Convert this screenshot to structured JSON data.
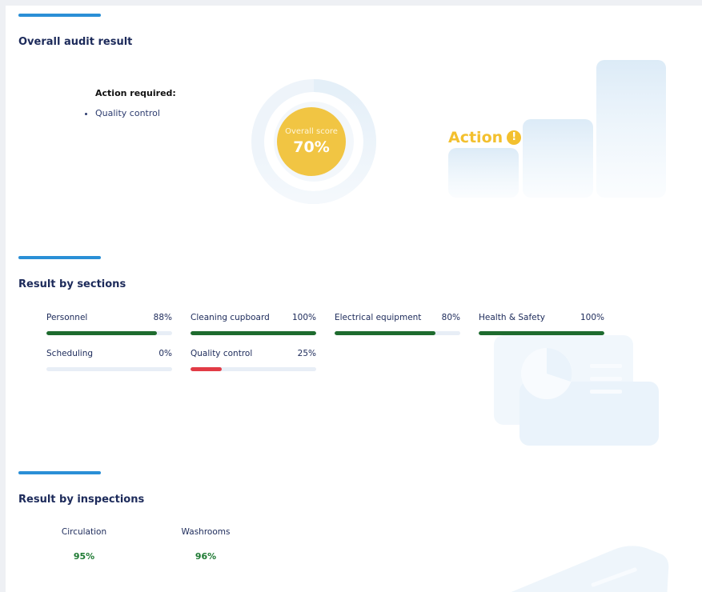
{
  "overall": {
    "title": "Overall audit result",
    "action_required_label": "Action required:",
    "action_items": [
      "Quality control"
    ],
    "score_label": "Overall score",
    "score_value": "70%",
    "score_fraction": 0.7,
    "status_text": "Action",
    "status_icon": "exclamation-icon",
    "status_color": "#f3c02e"
  },
  "sections": {
    "title": "Result by sections",
    "items": [
      {
        "name": "Personnel",
        "value": "88%",
        "fraction": 0.88,
        "color": "#1e6b2e"
      },
      {
        "name": "Cleaning cupboard",
        "value": "100%",
        "fraction": 1.0,
        "color": "#1e6b2e"
      },
      {
        "name": "Electrical equipment",
        "value": "80%",
        "fraction": 0.8,
        "color": "#1e6b2e"
      },
      {
        "name": "Health & Safety",
        "value": "100%",
        "fraction": 1.0,
        "color": "#1e6b2e"
      },
      {
        "name": "Scheduling",
        "value": "0%",
        "fraction": 0.0,
        "color": "#1e6b2e"
      },
      {
        "name": "Quality control",
        "value": "25%",
        "fraction": 0.25,
        "color": "#e23b46"
      }
    ]
  },
  "inspections": {
    "title": "Result by inspections",
    "items": [
      {
        "name": "Circulation",
        "value": "95%"
      },
      {
        "name": "Washrooms",
        "value": "96%"
      }
    ]
  },
  "colors": {
    "accent": "#2a8fd6",
    "heading": "#1c2a5a",
    "good": "#1e7a33",
    "bad": "#e23b46"
  }
}
